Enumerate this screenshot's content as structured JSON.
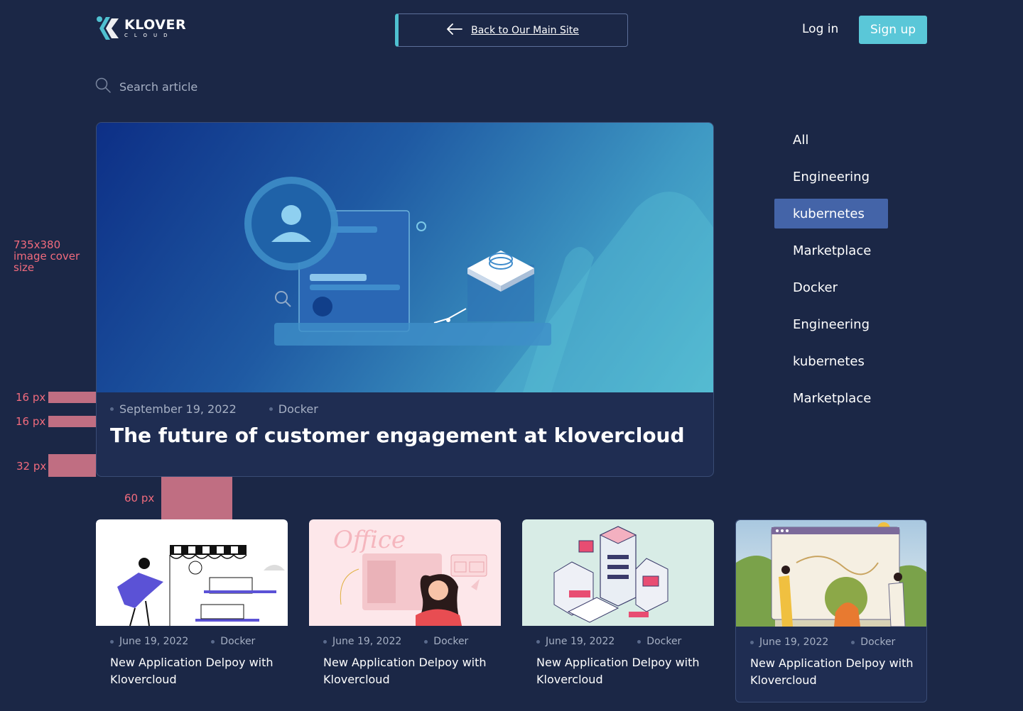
{
  "header": {
    "logo_word": "KLOVER",
    "logo_sub": "CLOUD",
    "back_label": "Back to Our Main Site",
    "login_label": "Log in",
    "signup_label": "Sign up"
  },
  "search": {
    "placeholder": "Search article"
  },
  "annotations": {
    "cover_size": "735x380 image cover size",
    "gap_16a": "16 px",
    "gap_16b": "16 px",
    "gap_32": "32 px",
    "gap_60": "60 px"
  },
  "featured": {
    "date": "September 19, 2022",
    "category": "Docker",
    "title": "The future of customer engagement at klovercloud"
  },
  "categories": [
    {
      "label": "All",
      "active": false
    },
    {
      "label": "Engineering",
      "active": false
    },
    {
      "label": "kubernetes",
      "active": true
    },
    {
      "label": "Marketplace",
      "active": false
    },
    {
      "label": "Docker",
      "active": false
    },
    {
      "label": "Engineering",
      "active": false
    },
    {
      "label": "kubernetes",
      "active": false
    },
    {
      "label": "Marketplace",
      "active": false
    }
  ],
  "cards": [
    {
      "date": "June 19, 2022",
      "category": "Docker",
      "title": "New Application Delpoy with Klovercloud"
    },
    {
      "date": "June 19, 2022",
      "category": "Docker",
      "title": "New Application Delpoy with Klovercloud"
    },
    {
      "date": "June 19, 2022",
      "category": "Docker",
      "title": "New Application Delpoy with Klovercloud"
    },
    {
      "date": "June 19, 2022",
      "category": "Docker",
      "title": "New Application Delpoy with Klovercloud"
    }
  ],
  "colors": {
    "background": "#1b2746",
    "accent": "#5ac7d8",
    "active_category": "#4464a8",
    "annotation": "#f26b7d"
  }
}
